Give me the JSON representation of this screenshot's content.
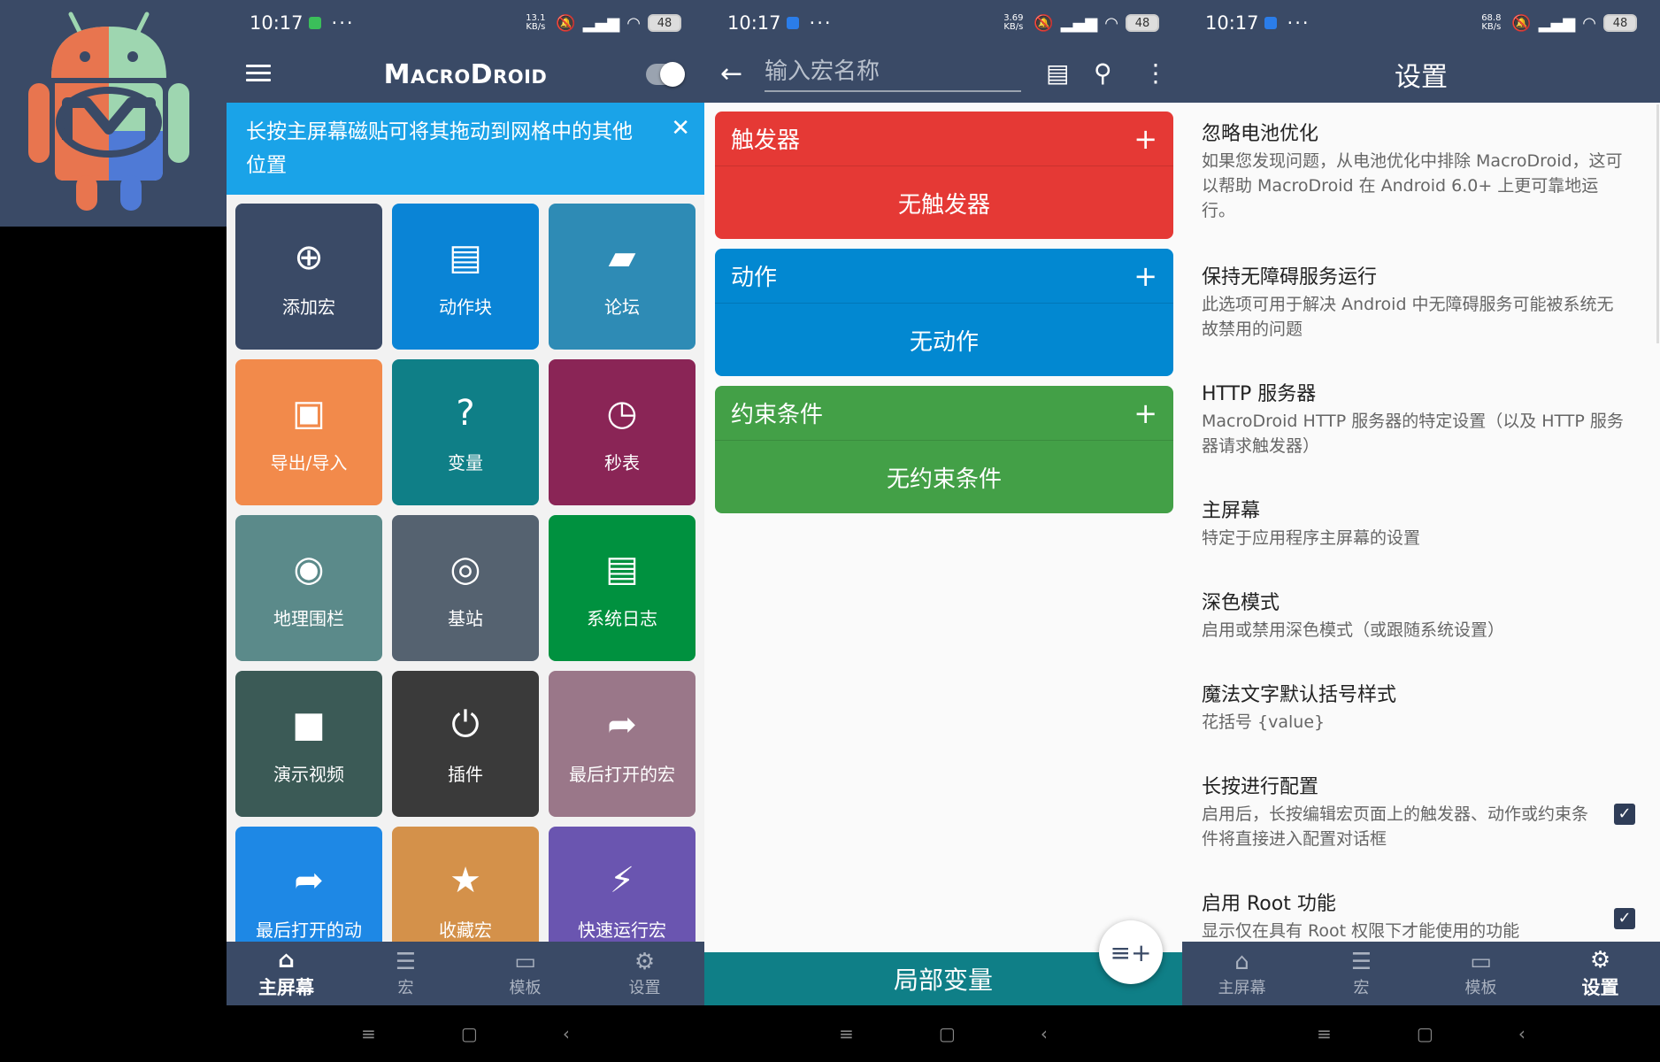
{
  "colors": {
    "primary": "#3a4a66",
    "tip": "#1aa3e8",
    "trigger": "#e53935",
    "action": "#0288d1",
    "constraint": "#43a047",
    "local_vars": "#0f7f87"
  },
  "status": {
    "time": "10:17",
    "more": "···",
    "speed1": "13.1 KB/s",
    "speed2": "3.69 KB/s",
    "speed3": "68.8 KB/s",
    "battery": "48"
  },
  "home": {
    "brand": "MacroDroid",
    "tip_text": "长按主屏幕磁贴可将其拖动到网格中的其他位置",
    "tiles": [
      {
        "label": "添加宏",
        "icon": "add-circle-icon",
        "glyph": "⊕",
        "color": "#3a4a66"
      },
      {
        "label": "动作块",
        "icon": "library-icon",
        "glyph": "▤",
        "color": "#0a84d6"
      },
      {
        "label": "论坛",
        "icon": "forum-icon",
        "glyph": "▰",
        "color": "#2e8bb5"
      },
      {
        "label": "导出/导入",
        "icon": "save-icon",
        "glyph": "▣",
        "color": "#f28a4b"
      },
      {
        "label": "变量",
        "icon": "help-box-icon",
        "glyph": "?",
        "color": "#0f7f87"
      },
      {
        "label": "秒表",
        "icon": "timer-icon",
        "glyph": "◷",
        "color": "#8a2556"
      },
      {
        "label": "地理围栏",
        "icon": "location-icon",
        "glyph": "◉",
        "color": "#5b8a8a"
      },
      {
        "label": "基站",
        "icon": "cell-tower-icon",
        "glyph": "◎",
        "color": "#556270"
      },
      {
        "label": "系统日志",
        "icon": "log-icon",
        "glyph": "▤",
        "color": "#00913f"
      },
      {
        "label": "演示视频",
        "icon": "video-icon",
        "glyph": "■",
        "color": "#3b5a56"
      },
      {
        "label": "插件",
        "icon": "plug-icon",
        "glyph": "⏻",
        "color": "#3a3a3a"
      },
      {
        "label": "最后打开的宏",
        "icon": "share-arrow-icon",
        "glyph": "➦",
        "color": "#9a7789"
      },
      {
        "label": "最后打开的动",
        "icon": "share-arrow-icon",
        "glyph": "➦",
        "color": "#1e88e5"
      },
      {
        "label": "收藏宏",
        "icon": "star-icon",
        "glyph": "★",
        "color": "#d4914a"
      },
      {
        "label": "快速运行宏",
        "icon": "run-icon",
        "glyph": "⚡",
        "color": "#6a55b0"
      }
    ]
  },
  "bottom_nav": {
    "home": "主屏幕",
    "macros": "宏",
    "templates": "模板",
    "settings": "设置"
  },
  "editor": {
    "name_placeholder": "输入宏名称",
    "trigger_title": "触发器",
    "trigger_empty": "无触发器",
    "action_title": "动作",
    "action_empty": "无动作",
    "constraint_title": "约束条件",
    "constraint_empty": "无约束条件",
    "local_vars": "局部变量"
  },
  "settings": {
    "title": "设置",
    "items": [
      {
        "title": "忽略电池优化",
        "desc": "如果您发现问题，从电池优化中排除 MacroDroid，这可以帮助 MacroDroid 在 Android 6.0+ 上更可靠地运行。"
      },
      {
        "title": "保持无障碍服务运行",
        "desc": "此选项可用于解决 Android 中无障碍服务可能被系统无故禁用的问题"
      },
      {
        "title": "HTTP 服务器",
        "desc": "MacroDroid HTTP 服务器的特定设置（以及 HTTP 服务器请求触发器）"
      },
      {
        "title": "主屏幕",
        "desc": "特定于应用程序主屏幕的设置"
      },
      {
        "title": "深色模式",
        "desc": "启用或禁用深色模式（或跟随系统设置）"
      },
      {
        "title": "魔法文字默认括号样式",
        "desc": "花括号 {value}"
      },
      {
        "title": "长按进行配置",
        "desc": "启用后，长按编辑宏页面上的触发器、动作或约束条件将直接进入配置对话框",
        "checked": true
      },
      {
        "title": "启用 Root 功能",
        "desc": "显示仅在具有 Root 权限下才能使用的功能",
        "checked": true
      }
    ]
  }
}
